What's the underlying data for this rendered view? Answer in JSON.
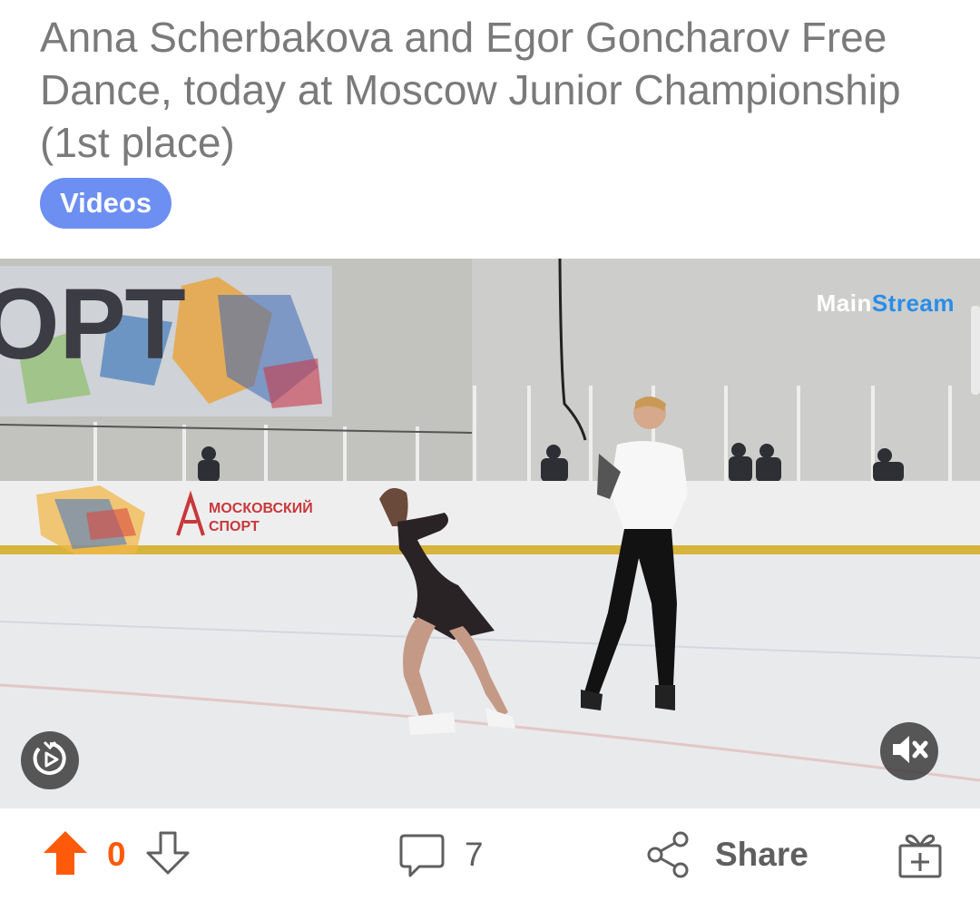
{
  "post": {
    "title": "Anna Scherbakova and Egor Goncharov Free Dance, today at Moscow Junior Championship (1st place)",
    "flair": "Videos"
  },
  "video": {
    "watermark_main": "Main",
    "watermark_stream": "Stream",
    "banner_text": "ОРТ",
    "board_text_1": "МОСКОВСКИЙ",
    "board_text_2": "СПОРТ",
    "muted": true
  },
  "actions": {
    "vote_count": "0",
    "comment_count": "7",
    "share_label": "Share"
  },
  "colors": {
    "title": "#7a7a7a",
    "flair_bg": "#6d8ff2",
    "upvote": "#ff5a0a",
    "icon": "#5f5f5f"
  }
}
